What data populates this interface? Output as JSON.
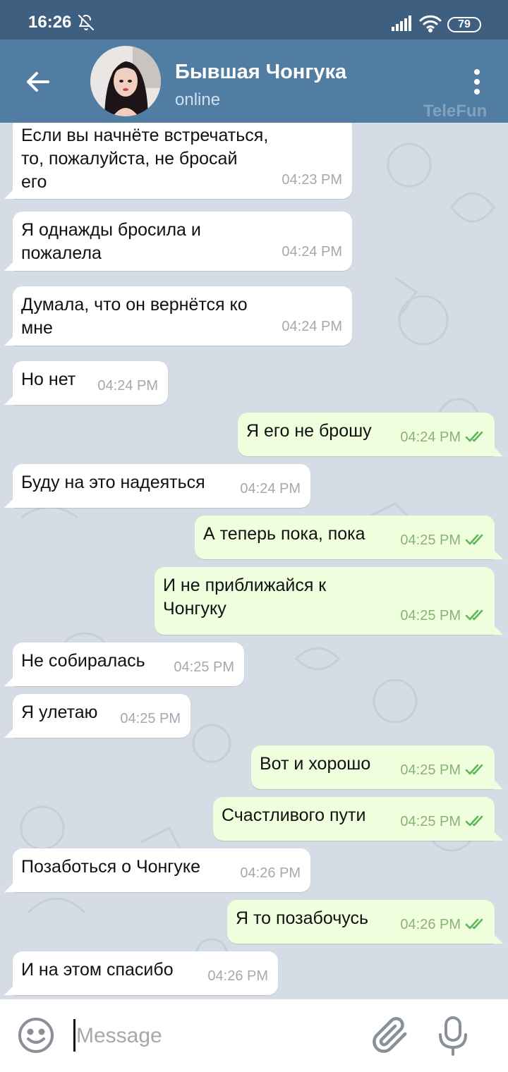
{
  "status_bar": {
    "time": "16:26",
    "battery": "79"
  },
  "header": {
    "title": "Бывшая Чонгука",
    "status": "online",
    "watermark": "TeleFun"
  },
  "messages": [
    {
      "dir": "in",
      "text": "Если вы начнёте встречаться,\nто, пожалуйста, не бросай\nего",
      "time": "04:23 PM"
    },
    {
      "dir": "in",
      "text": "Я однажды бросила и\nпожалела",
      "time": "04:24 PM"
    },
    {
      "dir": "in",
      "text": "Думала, что он вернётся ко\nмне",
      "time": "04:24 PM"
    },
    {
      "dir": "in",
      "text": "Но нет",
      "time": "04:24 PM"
    },
    {
      "dir": "out",
      "text": "Я его не брошу",
      "time": "04:24 PM"
    },
    {
      "dir": "in",
      "text": "Буду на это надеяться",
      "time": "04:24 PM"
    },
    {
      "dir": "out",
      "text": "А теперь пока, пока",
      "time": "04:25 PM"
    },
    {
      "dir": "out",
      "text": "И не приближайся к\nЧонгуку",
      "time": "04:25 PM"
    },
    {
      "dir": "in",
      "text": "Не собиралась",
      "time": "04:25 PM"
    },
    {
      "dir": "in",
      "text": "Я улетаю",
      "time": "04:25 PM"
    },
    {
      "dir": "out",
      "text": "Вот и хорошо",
      "time": "04:25 PM"
    },
    {
      "dir": "out",
      "text": "Счастливого пути",
      "time": "04:25 PM"
    },
    {
      "dir": "in",
      "text": "Позаботься о Чонгуке",
      "time": "04:26 PM"
    },
    {
      "dir": "out",
      "text": "Я то позабочусь",
      "time": "04:26 PM"
    },
    {
      "dir": "in",
      "text": "И на этом спасибо",
      "time": "04:26 PM"
    }
  ],
  "composer": {
    "placeholder": "Message"
  },
  "icons": {
    "back": "arrow-left-icon",
    "menu": "more-vertical-icon",
    "emoji": "emoji-icon",
    "attach": "paperclip-icon",
    "mic": "microphone-icon",
    "read": "double-check-icon"
  },
  "colors": {
    "header": "#517da2",
    "status_bar": "#3f5f81",
    "incoming_bubble": "#ffffff",
    "outgoing_bubble": "#efffde",
    "read_ticks": "#5eb55c"
  }
}
